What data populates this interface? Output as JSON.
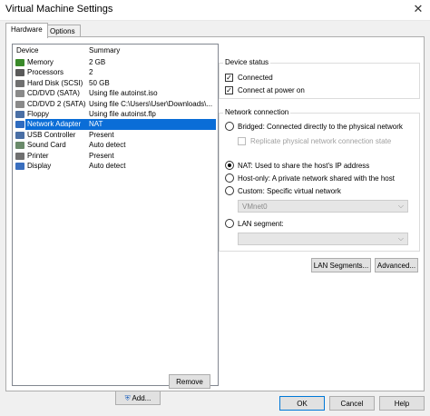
{
  "window": {
    "title": "Virtual Machine Settings"
  },
  "tabs": [
    {
      "label": "Hardware"
    },
    {
      "label": "Options"
    }
  ],
  "device_list": {
    "columns": [
      "Device",
      "Summary"
    ],
    "rows": [
      {
        "name": "Memory",
        "summary": "2 GB",
        "icon": "memory-icon",
        "color": "#3a8a2a"
      },
      {
        "name": "Processors",
        "summary": "2",
        "icon": "processor-icon",
        "color": "#5a5a5a"
      },
      {
        "name": "Hard Disk (SCSI)",
        "summary": "50 GB",
        "icon": "hard-disk-icon",
        "color": "#707070"
      },
      {
        "name": "CD/DVD (SATA)",
        "summary": "Using file autoinst.iso",
        "icon": "cd-dvd-icon",
        "color": "#8a8a8a"
      },
      {
        "name": "CD/DVD 2 (SATA)",
        "summary": "Using file C:\\Users\\User\\Downloads\\...",
        "icon": "cd-dvd-icon",
        "color": "#8a8a8a"
      },
      {
        "name": "Floppy",
        "summary": "Using file autoinst.flp",
        "icon": "floppy-icon",
        "color": "#4a6fa5"
      },
      {
        "name": "Network Adapter",
        "summary": "NAT",
        "icon": "network-adapter-icon",
        "color": "#2e6bbf"
      },
      {
        "name": "USB Controller",
        "summary": "Present",
        "icon": "usb-icon",
        "color": "#4a6fa5"
      },
      {
        "name": "Sound Card",
        "summary": "Auto detect",
        "icon": "sound-card-icon",
        "color": "#6a8a6a"
      },
      {
        "name": "Printer",
        "summary": "Present",
        "icon": "printer-icon",
        "color": "#707070"
      },
      {
        "name": "Display",
        "summary": "Auto detect",
        "icon": "display-icon",
        "color": "#3a6fbf"
      }
    ],
    "selected_index": 6
  },
  "buttons": {
    "add": "Add...",
    "remove": "Remove",
    "lan_segments": "LAN Segments...",
    "advanced": "Advanced...",
    "ok": "OK",
    "cancel": "Cancel",
    "help": "Help"
  },
  "device_status": {
    "legend": "Device status",
    "connected": {
      "label": "Connected",
      "checked": true
    },
    "connect_at_power_on": {
      "label": "Connect at power on",
      "checked": true
    }
  },
  "network_connection": {
    "legend": "Network connection",
    "bridged": "Bridged: Connected directly to the physical network",
    "replicate": "Replicate physical network connection state",
    "nat": "NAT: Used to share the host's IP address",
    "host_only": "Host-only: A private network shared with the host",
    "custom": "Custom: Specific virtual network",
    "custom_value": "VMnet0",
    "lan_segment": "LAN segment:",
    "lan_segment_value": "",
    "selected": "nat"
  },
  "colors": {
    "selection": "#0a6dd7",
    "focus_border": "#0078d7"
  }
}
